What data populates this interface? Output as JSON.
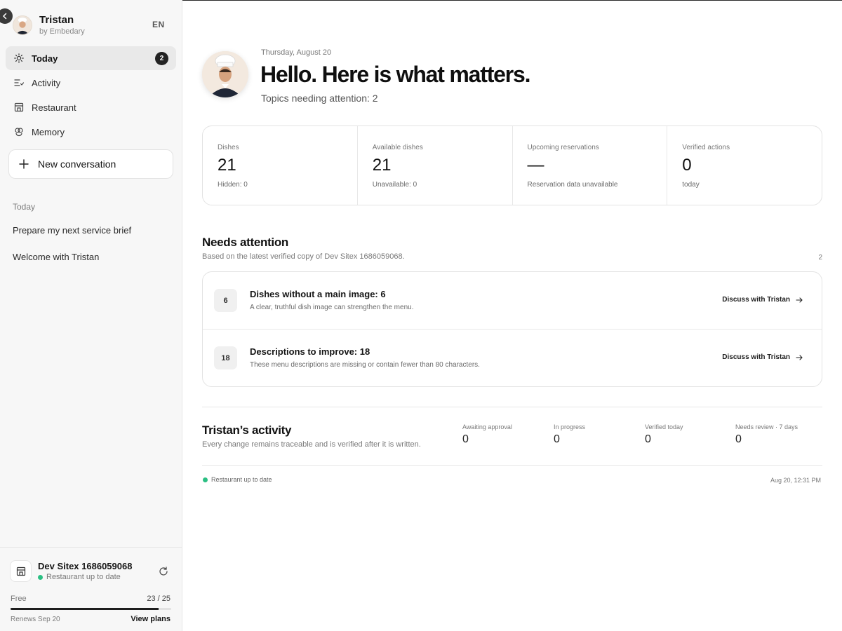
{
  "profile": {
    "name": "Tristan",
    "subtitle": "by Embedary",
    "language": "EN"
  },
  "nav": {
    "items": [
      {
        "label": "Today",
        "badge": "2",
        "icon": "sun-icon"
      },
      {
        "label": "Activity",
        "icon": "activity-list-icon"
      },
      {
        "label": "Restaurant",
        "icon": "store-icon"
      },
      {
        "label": "Memory",
        "icon": "memory-icon"
      }
    ]
  },
  "new_conversation": {
    "label": "New conversation"
  },
  "history": {
    "heading": "Today",
    "items": [
      "Prepare my next service brief",
      "Welcome with Tristan"
    ]
  },
  "site": {
    "name": "Dev Sitex 1686059068",
    "status": "Restaurant up to date",
    "plan": "Free",
    "usage": "23 / 25",
    "usage_fraction": 0.92,
    "renews": "Renews Sep 20",
    "view_plans": "View plans"
  },
  "hero": {
    "date": "Thursday, August 20",
    "title": "Hello. Here is what matters.",
    "subtitle": "Topics needing attention: 2"
  },
  "stats": [
    {
      "label": "Dishes",
      "value": "21",
      "note": "Hidden: 0"
    },
    {
      "label": "Available dishes",
      "value": "21",
      "note": "Unavailable: 0"
    },
    {
      "label": "Upcoming reservations",
      "value": "—",
      "note": "Reservation data unavailable"
    },
    {
      "label": "Verified actions",
      "value": "0",
      "note": "today"
    }
  ],
  "attention": {
    "title": "Needs attention",
    "subtitle": "Based on the latest verified copy of Dev Sitex 1686059068.",
    "count": "2",
    "items": [
      {
        "number": "6",
        "title": "Dishes without a main image: 6",
        "description": "A clear, truthful dish image can strengthen the menu.",
        "action": "Discuss with Tristan"
      },
      {
        "number": "18",
        "title": "Descriptions to improve: 18",
        "description": "These menu descriptions are missing or contain fewer than 80 characters.",
        "action": "Discuss with Tristan"
      }
    ]
  },
  "activity": {
    "title": "Tristan’s activity",
    "subtitle": "Every change remains traceable and is verified after it is written.",
    "metrics": [
      {
        "label": "Awaiting approval",
        "value": "0"
      },
      {
        "label": "In progress",
        "value": "0"
      },
      {
        "label": "Verified today",
        "value": "0"
      },
      {
        "label": "Needs review · 7 days",
        "value": "0"
      }
    ]
  },
  "footer": {
    "status": "Restaurant up to date",
    "timestamp": "Aug 20, 12:31 PM"
  },
  "colors": {
    "status_green": "#2bbf83",
    "badge": "#222222",
    "accent_text": "#111111"
  }
}
